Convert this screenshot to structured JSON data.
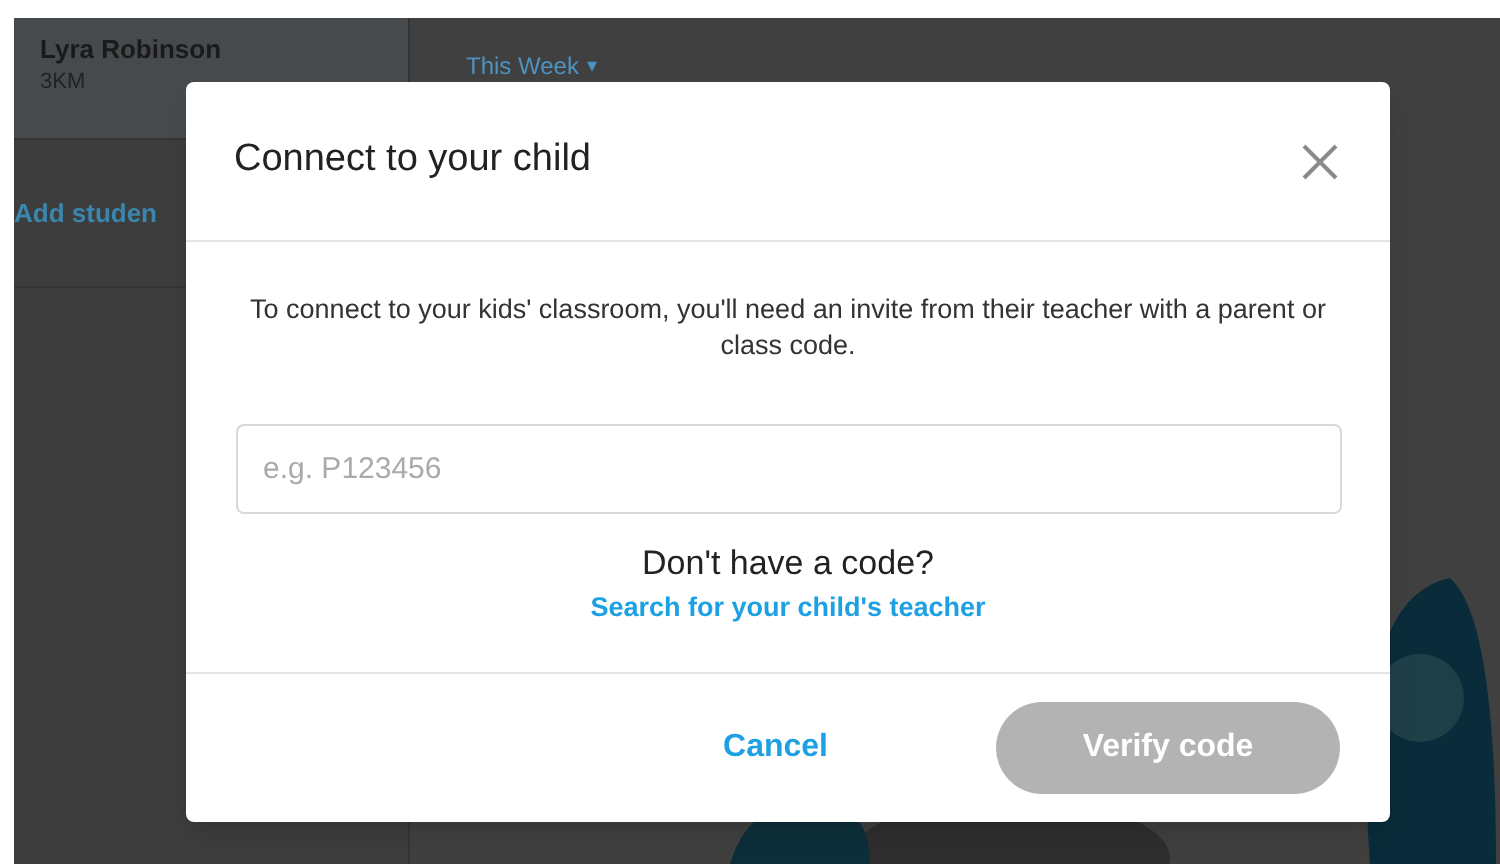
{
  "sidebar": {
    "student": {
      "name": "Lyra Robinson",
      "class": "3KM",
      "selected": true
    },
    "add_link": "Add studen"
  },
  "main": {
    "period_menu": "This Week",
    "caret": "▾"
  },
  "dialog": {
    "title": "Connect to your child",
    "description": "To connect to your kids' classroom, you'll need an invite from their teacher with a parent or class code.",
    "code_field": {
      "placeholder": "e.g. P123456"
    },
    "no_code_prompt": "Don't have a code?",
    "search_link": "Search for your child's teacher",
    "buttons": [
      {
        "label": "Cancel",
        "kind": "link",
        "disabled": false
      },
      {
        "label": "Verify code",
        "kind": "primary",
        "disabled": true
      }
    ]
  }
}
